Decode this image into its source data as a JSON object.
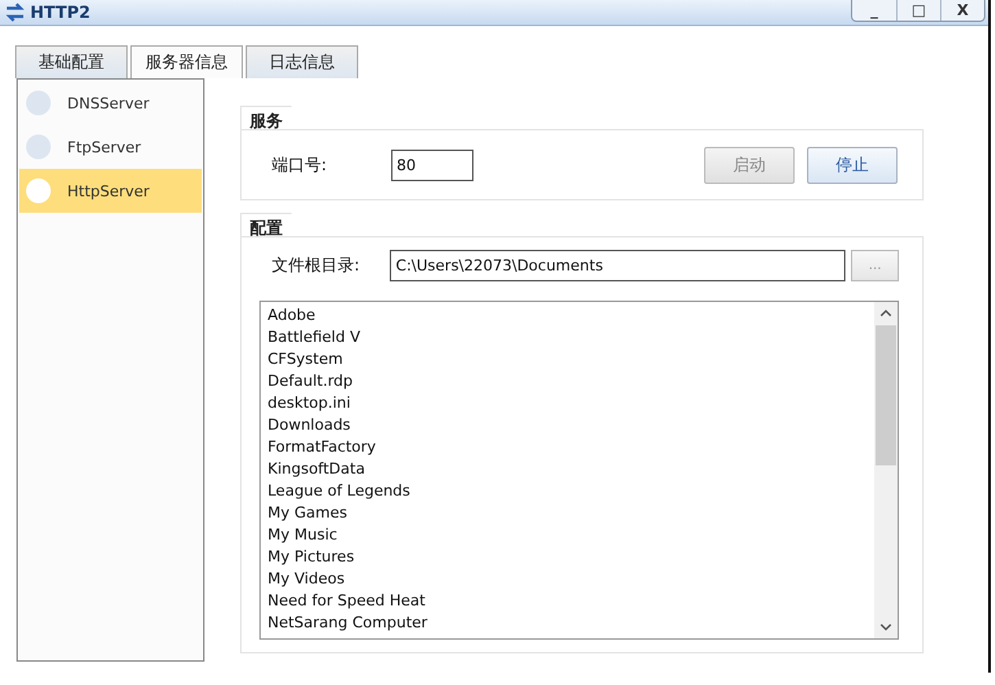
{
  "window": {
    "title": "HTTP2",
    "controls": [
      "_",
      "□",
      "X"
    ]
  },
  "tabs": [
    {
      "label": "基础配置",
      "selected": false
    },
    {
      "label": "服务器信息",
      "selected": true
    },
    {
      "label": "日志信息",
      "selected": false
    }
  ],
  "sidebar": {
    "items": [
      {
        "label": "DNSServer",
        "selected": false
      },
      {
        "label": "FtpServer",
        "selected": false
      },
      {
        "label": "HttpServer",
        "selected": true
      }
    ]
  },
  "service": {
    "title": "服务",
    "port_label": "端口号:",
    "port_value": "80",
    "buttons": [
      {
        "label": "启动",
        "disabled": true
      },
      {
        "label": "停止",
        "disabled": false
      }
    ]
  },
  "config": {
    "title": "配置",
    "root_label": "文件根目录:",
    "root_value": "C:\\Users\\22073\\Documents",
    "browse": "...",
    "files": [
      "Adobe",
      "Battlefield V",
      "CFSystem",
      "Default.rdp",
      "desktop.ini",
      "Downloads",
      "FormatFactory",
      "KingsoftData",
      "League of Legends",
      "My Games",
      "My Music",
      "My Pictures",
      "My Videos",
      "Need for Speed Heat",
      "NetSarang Computer"
    ]
  }
}
